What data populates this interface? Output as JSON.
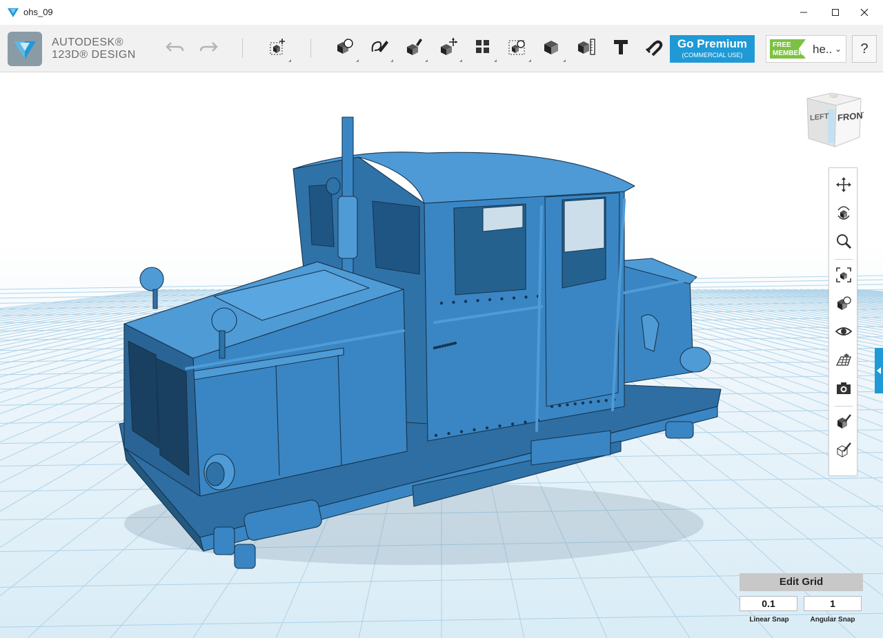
{
  "window": {
    "title": "ohs_09",
    "minimize_glyph": "—",
    "maximize_glyph": "☐",
    "close_glyph": "✕"
  },
  "brand": {
    "line1": "AUTODESK®",
    "line2": "123D® DESIGN"
  },
  "toolbar": {
    "icons": [
      "undo-icon",
      "redo-icon",
      "transform-icon",
      "primitives-icon",
      "sketch-icon",
      "construct-icon",
      "modify-icon",
      "pattern-icon",
      "grouping-icon",
      "combine-icon",
      "measure-icon",
      "text-icon",
      "snap-icon"
    ]
  },
  "premium": {
    "label": "Go Premium",
    "sublabel": "(COMMERCIAL USE)"
  },
  "account": {
    "badge_line1": "FREE",
    "badge_line2": "MEMBER",
    "user": "he..",
    "caret": "⌄"
  },
  "help": {
    "label": "?"
  },
  "navcube": {
    "left_label": "LEFT",
    "front_label": "FRONT",
    "top_label": "TOP"
  },
  "view_tools": [
    "pan-icon",
    "orbit-icon",
    "zoom-icon",
    "fit-icon",
    "views-icon",
    "visibility-icon",
    "grid-toggle-icon",
    "screenshot-icon",
    "materials-icon",
    "outline-icon"
  ],
  "edit_grid": {
    "title": "Edit Grid",
    "linear_snap_value": "0.1",
    "angular_snap_value": "1",
    "linear_snap_label": "Linear Snap",
    "angular_snap_label": "Angular Snap"
  },
  "colors": {
    "accent": "#1f9ad6",
    "model": "#3a86c4",
    "model_dark": "#2b6c9f",
    "grid": "#a8cfe6",
    "free_badge": "#7cc242"
  }
}
